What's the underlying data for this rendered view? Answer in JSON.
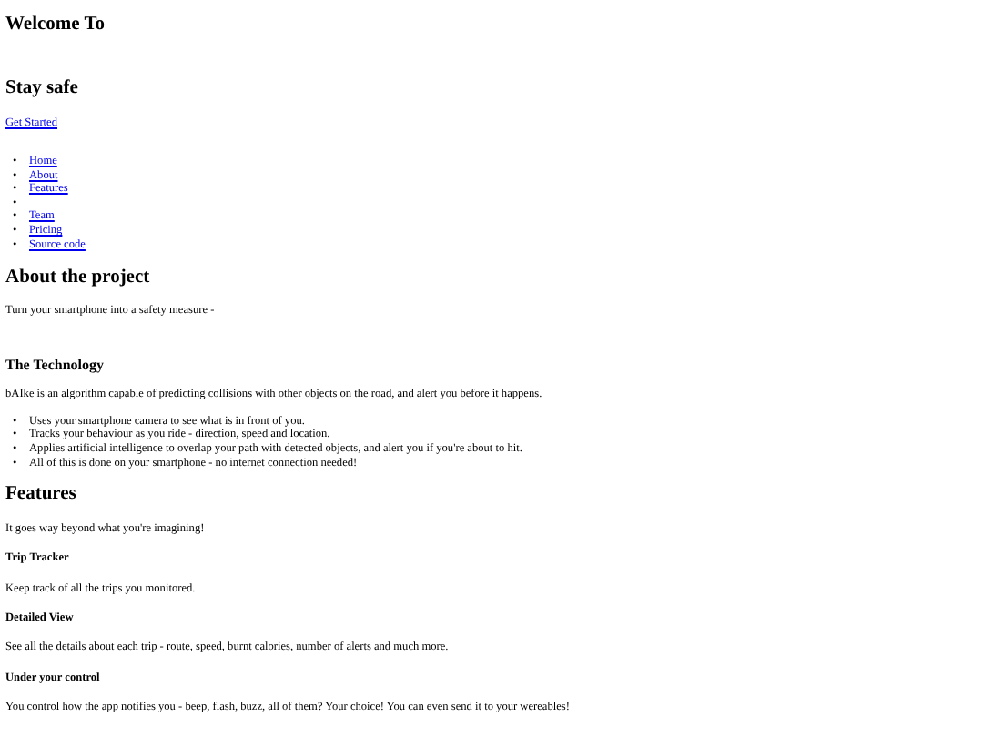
{
  "hero": {
    "title": "Welcome To",
    "subtitle": "Stay safe",
    "cta": "Get Started"
  },
  "nav": [
    {
      "kind": "link",
      "marker": "•",
      "label": "Home"
    },
    {
      "kind": "link",
      "marker": "•",
      "label": "About"
    },
    {
      "kind": "link",
      "marker": "•",
      "label": "Features"
    },
    {
      "kind": "blank",
      "marker": "•"
    },
    {
      "kind": "link",
      "marker": "•",
      "label": "Team"
    },
    {
      "kind": "link",
      "marker": "•",
      "label": "Pricing"
    },
    {
      "kind": "link",
      "marker": "•",
      "label": "Source code"
    }
  ],
  "about": {
    "title": "About the project",
    "intro": "Turn your smartphone into a safety measure -",
    "technology": {
      "title": "The Technology",
      "text": "bAIke is an algorithm capable of predicting collisions with other objects on the road, and alert you before it happens.",
      "points": [
        {
          "marker": "•",
          "text": "Uses your smartphone camera to see what is in front of you."
        },
        {
          "marker": "•",
          "text": "Tracks your behaviour as you ride - direction, speed and location."
        },
        {
          "marker": "•",
          "text": "Applies artificial intelligence to overlap your path with detected objects, and alert you if you're about to hit."
        },
        {
          "marker": "•",
          "text": "All of this is done on your smartphone - no internet connection needed!"
        }
      ]
    }
  },
  "features": {
    "title": "Features",
    "intro": "It goes way beyond what you're imagining!",
    "items": [
      {
        "title": "Trip Tracker",
        "text": "Keep track of all the trips you monitored."
      },
      {
        "title": "Detailed View",
        "text": "See all the details about each trip - route, speed, burnt calories, number of alerts and much more."
      },
      {
        "title": "Under your control",
        "text": "You control how the app notifies you - beep, flash, buzz, all of them? Your choice! You can even send it to your wereables!"
      }
    ]
  }
}
